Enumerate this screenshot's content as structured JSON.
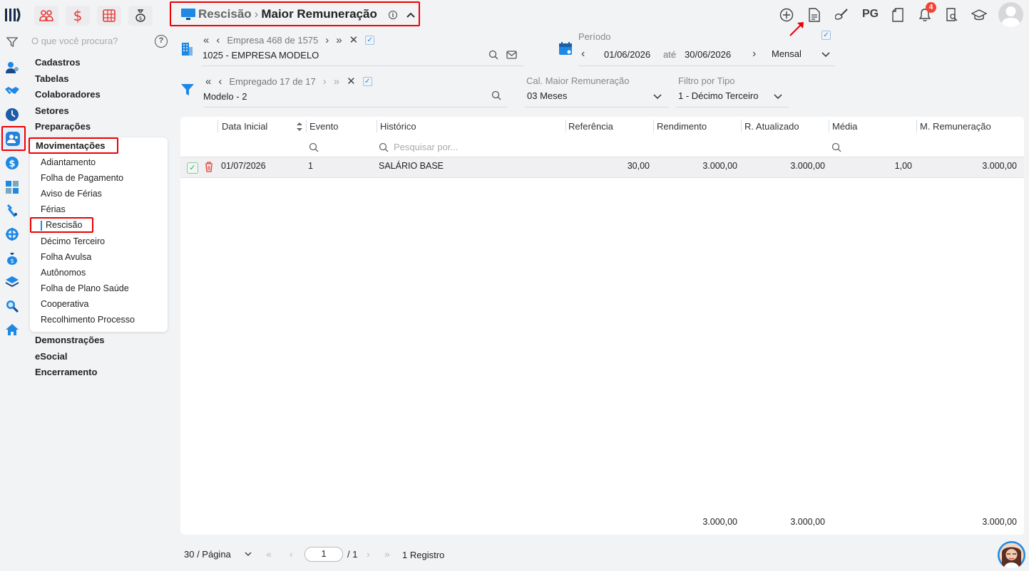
{
  "breadcrumb": {
    "parent": "Rescisão",
    "sep": "›",
    "current": "Maior Remuneração"
  },
  "search": {
    "placeholder": "O que você procura?"
  },
  "sidebar": {
    "sections": [
      "Cadastros",
      "Tabelas",
      "Colaboradores",
      "Setores",
      "Preparações",
      "Movimentações",
      "Demonstrações",
      "eSocial",
      "Encerramento"
    ],
    "sub_items": [
      "Adiantamento",
      "Folha de Pagamento",
      "Aviso de Férias",
      "Férias",
      "Rescisão",
      "Décimo Terceiro",
      "Folha Avulsa",
      "Autônomos",
      "Folha de Plano Saúde",
      "Cooperativa",
      "Recolhimento Processo"
    ]
  },
  "empresa": {
    "nav_text": "Empresa 468 de 1575",
    "value": "1025 - EMPRESA MODELO"
  },
  "periodo": {
    "label": "Período",
    "start": "01/06/2026",
    "ate": "até",
    "end": "30/06/2026",
    "tipo": "Mensal"
  },
  "empregado": {
    "nav_text": "Empregado 17 de 17",
    "value": "Modelo - 2"
  },
  "cal": {
    "label": "Cal. Maior Remuneração",
    "value": "03 Meses"
  },
  "filtro": {
    "label": "Filtro por Tipo",
    "value": "1 - Décimo Terceiro"
  },
  "table": {
    "columns": [
      "Data Inicial",
      "Evento",
      "Histórico",
      "Referência",
      "Rendimento",
      "R. Atualizado",
      "Média",
      "M. Remuneração"
    ],
    "search_placeholder": "Pesquisar por...",
    "rows": [
      {
        "data": "01/07/2026",
        "evento": "1",
        "historico": "SALÁRIO BASE",
        "referencia": "30,00",
        "rendimento": "3.000,00",
        "atualizado": "3.000,00",
        "media": "1,00",
        "remuneracao": "3.000,00"
      }
    ],
    "totals": {
      "rendimento": "3.000,00",
      "atualizado": "3.000,00",
      "remuneracao": "3.000,00"
    }
  },
  "pagination": {
    "per_page": "30 / Página",
    "page": "1",
    "total": "/ 1",
    "records": "1 Registro"
  },
  "header_right": {
    "pg": "PG",
    "notifications": "4"
  },
  "colors": {
    "accent": "#1e88e5",
    "red_highlight": "#e00000",
    "brand_red": "#e53935",
    "dark": "#1b2a4a"
  }
}
